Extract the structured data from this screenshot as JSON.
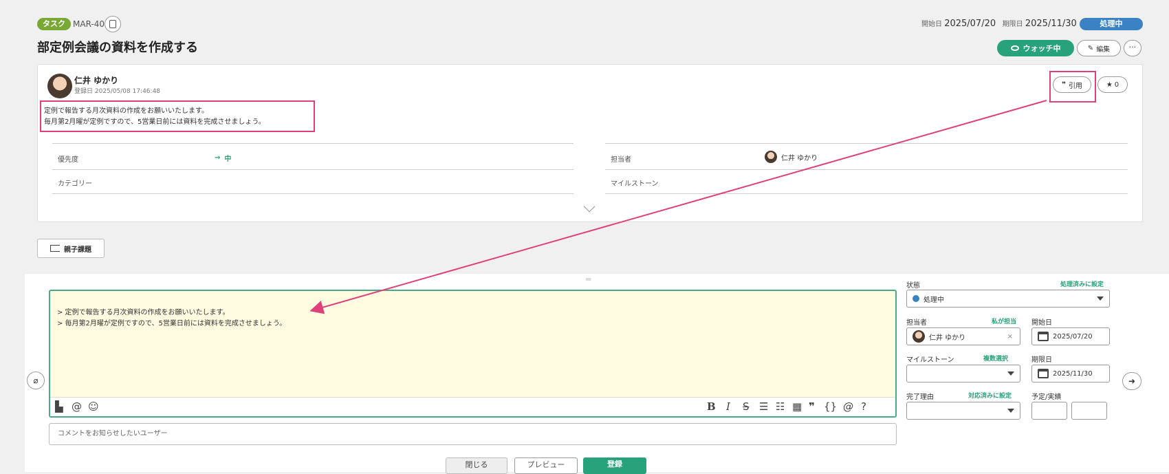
{
  "issue": {
    "type_badge": "タスク",
    "key": "MAR-40",
    "title": "部定例会議の資料を作成する",
    "start_label": "開始日",
    "start_date": "2025/07/20",
    "due_label": "期限日",
    "due_date": "2025/11/30",
    "status": "処理中"
  },
  "actions": {
    "watch": "ウォッチ中",
    "edit": "編集",
    "more": "···"
  },
  "detail": {
    "author": "仁井 ゆかり",
    "registered": "登録日 2025/05/08 17:46:48",
    "desc_line1": "定例で報告する月次資料の作成をお願いいたします。",
    "desc_line2": "毎月第2月曜が定例ですので、5営業日前には資料を完成させましょう。",
    "quote": "引用",
    "stars": "0"
  },
  "fields": {
    "priority_label": "優先度",
    "priority_value": "中",
    "category_label": "カテゴリー",
    "assignee_label": "担当者",
    "assignee_value": "仁井 ゆかり",
    "milestone_label": "マイルストーン"
  },
  "parent_button": "親子課題",
  "comment": {
    "line1": "> 定例で報告する月次資料の作成をお願いいたします。",
    "line2": "> 毎月第2月曜が定例ですので、5営業日前には資料を完成させましょう。",
    "notify_placeholder": "コメントをお知らせしたいユーザー",
    "toolbar_left": [
      "@",
      "☺"
    ],
    "toolbar_right": [
      "B",
      "I",
      "S",
      "☰",
      "☷",
      "▦",
      "❞",
      "{}",
      "@",
      "?"
    ]
  },
  "footer": {
    "close": "閉じる",
    "preview": "プレビュー",
    "submit": "登録"
  },
  "sidebar": {
    "status_label": "状態",
    "status_link": "処理済みに設定",
    "status_value": "処理中",
    "assignee_label": "担当者",
    "assignee_link": "私が担当",
    "assignee_value": "仁井 ゆかり",
    "start_label": "開始日",
    "start_value": "2025/07/20",
    "milestone_label": "マイルストーン",
    "milestone_link": "複数選択",
    "due_label": "期限日",
    "due_value": "2025/11/30",
    "resolution_label": "完了理由",
    "resolution_link": "対応済みに設定",
    "plan_label": "予定/実績"
  },
  "colors": {
    "accent": "#27a27a",
    "status": "#3b82c4",
    "highlight": "#e0407a",
    "editor_bg": "#fefbe0"
  }
}
